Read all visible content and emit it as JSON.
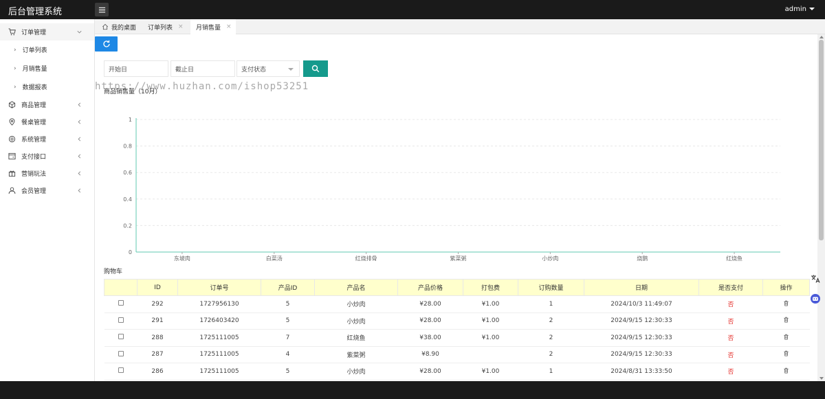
{
  "app": {
    "title": "后台管理系统",
    "user": "admin"
  },
  "sidebar": {
    "groups": [
      {
        "label": "订单管理",
        "icon": "cart-icon",
        "open": true,
        "items": [
          {
            "label": "订单列表"
          },
          {
            "label": "月销售量"
          },
          {
            "label": "数据报表"
          }
        ]
      },
      {
        "label": "商品管理",
        "icon": "cube-icon"
      },
      {
        "label": "餐桌管理",
        "icon": "location-icon"
      },
      {
        "label": "系统管理",
        "icon": "settings-icon"
      },
      {
        "label": "支付接口",
        "icon": "payment-icon"
      },
      {
        "label": "营销玩法",
        "icon": "gift-icon"
      },
      {
        "label": "会员管理",
        "icon": "user-icon"
      }
    ]
  },
  "tabs": [
    {
      "label": "我的桌面",
      "icon": "home-icon"
    },
    {
      "label": "订单列表"
    },
    {
      "label": "月销售量",
      "active": true
    }
  ],
  "filters": {
    "start_placeholder": "开始日",
    "end_placeholder": "截止日",
    "pay_status_placeholder": "支付状态"
  },
  "watermark": "https://www.huzhan.com/ishop53251",
  "chart_data": {
    "type": "line",
    "title": "商品销售量（10月）",
    "categories": [
      "东坡肉",
      "白菜汤",
      "红烧排骨",
      "紫菜粥",
      "小炒肉",
      "烧鹅",
      "红烧鱼"
    ],
    "series": [
      {
        "values": []
      }
    ],
    "ylim": [
      0,
      1
    ],
    "yticks": [
      "0",
      "0.2",
      "0.4",
      "0.6",
      "0.8",
      "1"
    ],
    "grid": true,
    "accent": "#5fc8b0"
  },
  "cart": {
    "title": "购物车",
    "columns": [
      "",
      "ID",
      "订单号",
      "产品ID",
      "产品名",
      "产品价格",
      "打包费",
      "订购数量",
      "日期",
      "是否支付",
      "操作"
    ],
    "rows": [
      {
        "id": "292",
        "order_no": "1727956130",
        "product_id": "5",
        "name": "小炒肉",
        "price": "¥28.00",
        "pack": "¥1.00",
        "qty": "1",
        "date": "2024/10/3 11:49:07",
        "paid": "否"
      },
      {
        "id": "291",
        "order_no": "1726403420",
        "product_id": "5",
        "name": "小炒肉",
        "price": "¥28.00",
        "pack": "¥1.00",
        "qty": "2",
        "date": "2024/9/15 12:30:33",
        "paid": "否"
      },
      {
        "id": "288",
        "order_no": "1725111005",
        "product_id": "7",
        "name": "红烧鱼",
        "price": "¥38.00",
        "pack": "¥1.00",
        "qty": "2",
        "date": "2024/9/15 12:30:33",
        "paid": "否"
      },
      {
        "id": "287",
        "order_no": "1725111005",
        "product_id": "4",
        "name": "紫菜粥",
        "price": "¥8.90",
        "pack": "",
        "qty": "2",
        "date": "2024/9/15 12:30:33",
        "paid": "否"
      },
      {
        "id": "286",
        "order_no": "1725111005",
        "product_id": "5",
        "name": "小炒肉",
        "price": "¥28.00",
        "pack": "¥1.00",
        "qty": "1",
        "date": "2024/8/31 13:33:50",
        "paid": "否"
      }
    ]
  },
  "colors": {
    "topbar": "#1a1a1a",
    "refresh": "#1e88e5",
    "search": "#159a8c",
    "header_row": "#ffffcc",
    "unpaid": "#e53935"
  }
}
